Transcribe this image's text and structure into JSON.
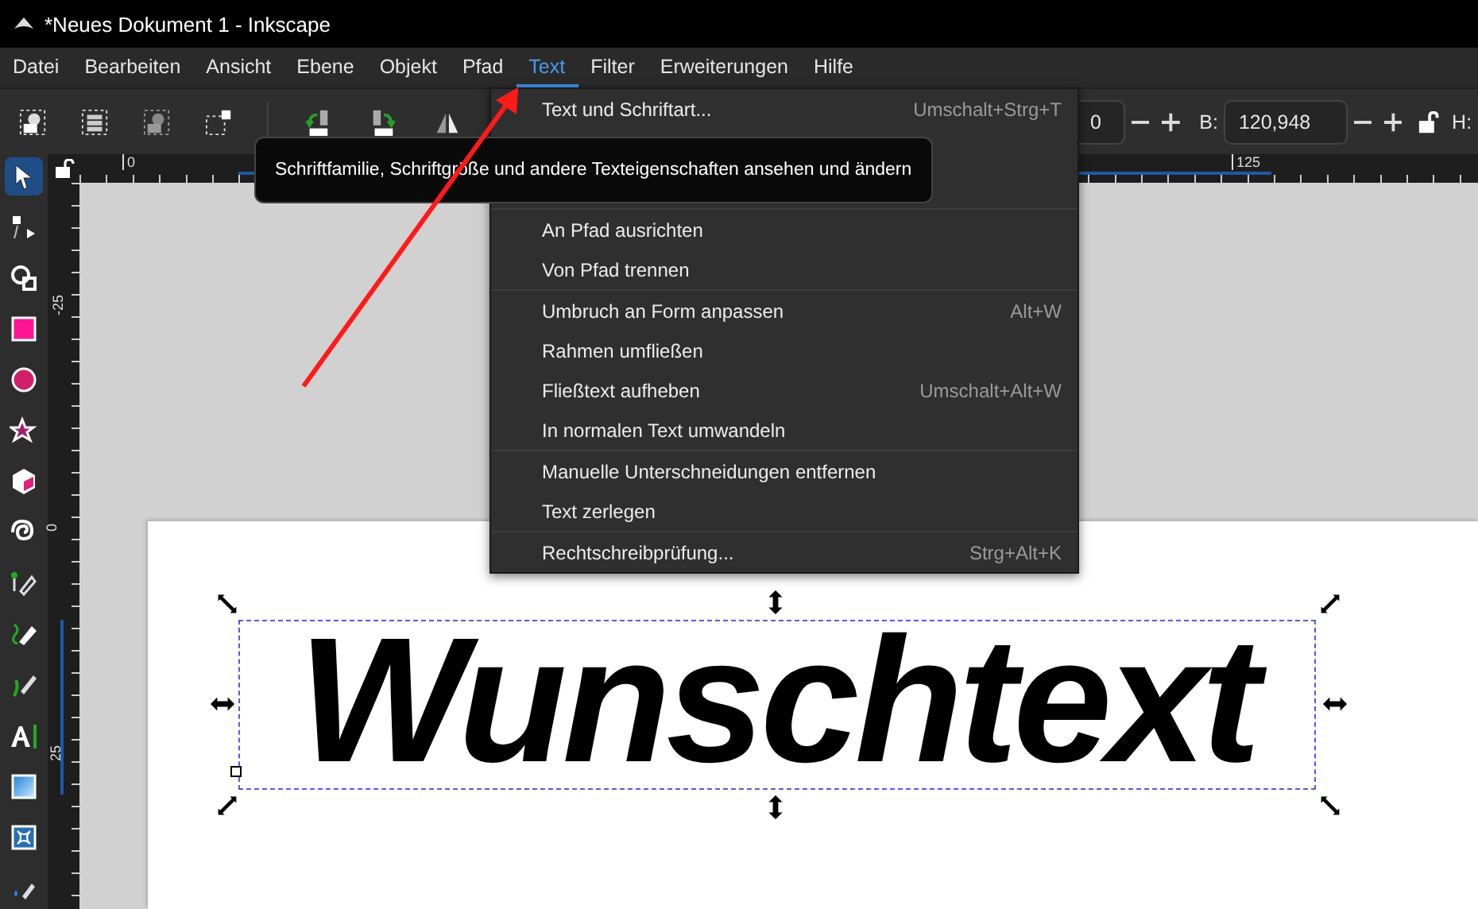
{
  "window": {
    "title": "*Neues Dokument 1 - Inkscape"
  },
  "menubar": [
    {
      "label": "Datei",
      "selected": false
    },
    {
      "label": "Bearbeiten",
      "selected": false
    },
    {
      "label": "Ansicht",
      "selected": false
    },
    {
      "label": "Ebene",
      "selected": false
    },
    {
      "label": "Objekt",
      "selected": false
    },
    {
      "label": "Pfad",
      "selected": false
    },
    {
      "label": "Text",
      "selected": true
    },
    {
      "label": "Filter",
      "selected": false
    },
    {
      "label": "Erweiterungen",
      "selected": false
    },
    {
      "label": "Hilfe",
      "selected": false
    }
  ],
  "toolbar": {
    "x_field": {
      "value": "0"
    },
    "b_field": {
      "label": "B:",
      "value": "120,948"
    },
    "h_label": "H:"
  },
  "rulers": {
    "horizontal": [
      "0",
      "125"
    ],
    "vertical": [
      "-25",
      "0",
      "25"
    ]
  },
  "tools": [
    {
      "kind": "selector",
      "selected": true
    },
    {
      "kind": "node",
      "selected": false
    },
    {
      "kind": "tweak",
      "selected": false
    },
    {
      "kind": "rect",
      "selected": false
    },
    {
      "kind": "circle",
      "selected": false
    },
    {
      "kind": "star",
      "selected": false
    },
    {
      "kind": "box3d",
      "selected": false
    },
    {
      "kind": "spiral",
      "selected": false
    },
    {
      "kind": "pen",
      "selected": false
    },
    {
      "kind": "pencil",
      "selected": false
    },
    {
      "kind": "calligraphy",
      "selected": false
    },
    {
      "kind": "text",
      "selected": false
    },
    {
      "kind": "gradient",
      "selected": false
    },
    {
      "kind": "mesh",
      "selected": false
    },
    {
      "kind": "dropper",
      "selected": false
    }
  ],
  "text_menu": [
    [
      {
        "label": "Text und Schriftart...",
        "shortcut": "Umschalt+Strg+T"
      }
    ],
    [
      {
        "label": "An Pfad ausrichten"
      },
      {
        "label": "Von Pfad trennen"
      }
    ],
    [
      {
        "label": "Umbruch an Form anpassen",
        "shortcut": "Alt+W"
      },
      {
        "label": "Rahmen umfließen"
      },
      {
        "label": "Fließtext aufheben",
        "shortcut": "Umschalt+Alt+W"
      },
      {
        "label": "In normalen Text umwandeln"
      }
    ],
    [
      {
        "label": "Manuelle Unterschneidungen entfernen"
      },
      {
        "label": "Text zerlegen"
      }
    ],
    [
      {
        "label": "Rechtschreibprüfung...",
        "shortcut": "Strg+Alt+K"
      }
    ]
  ],
  "tooltip": "Schriftfamilie, Schriftgröße und andere Texteigenschaften ansehen und ändern",
  "canvas": {
    "text": "Wunschtext"
  }
}
